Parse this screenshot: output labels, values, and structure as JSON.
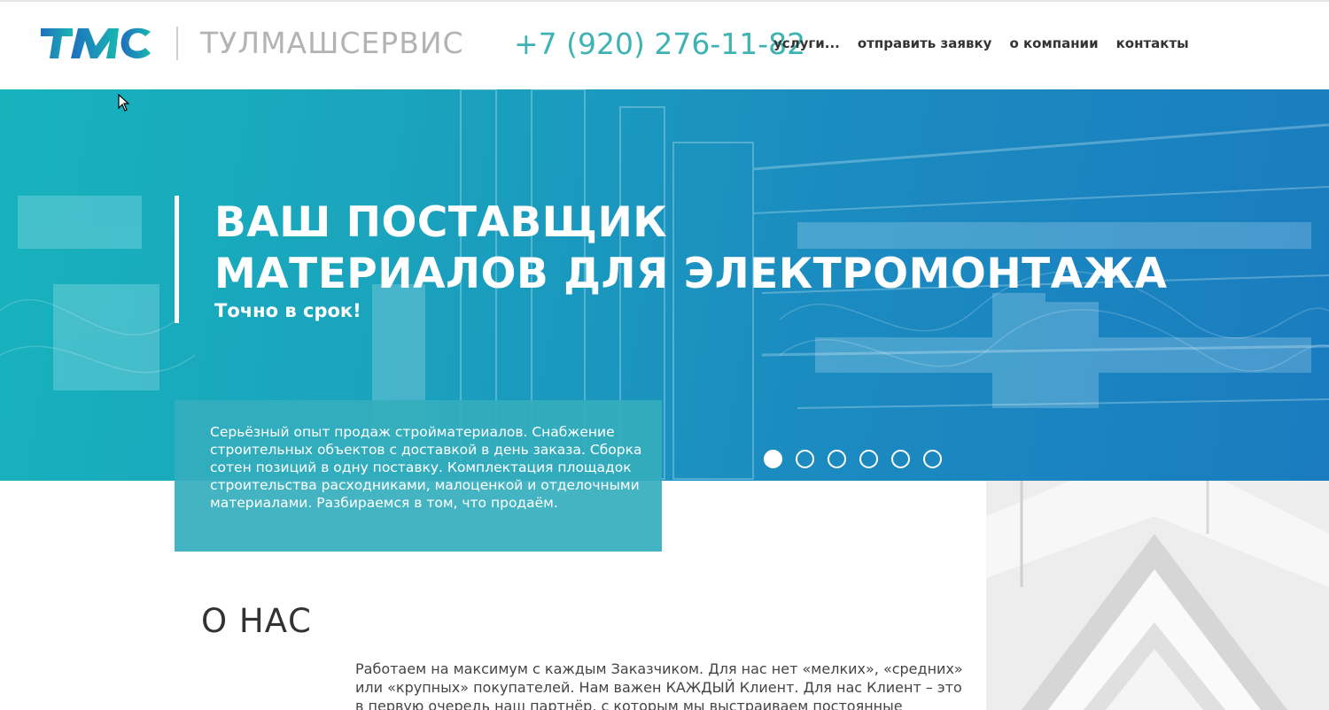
{
  "header": {
    "logo_text": "ТУЛМАШСЕРВИС",
    "phone": "+7 (920) 276-11-82",
    "nav": [
      {
        "label": "услуги..."
      },
      {
        "label": "отправить заявку"
      },
      {
        "label": "о компании"
      },
      {
        "label": "контакты"
      }
    ]
  },
  "hero": {
    "title_line1": "ВАШ ПОСТАВЩИК",
    "title_line2": "МАТЕРИАЛОВ ДЛЯ ЭЛЕКТРОМОНТАЖА",
    "subtitle": "Точно в срок!",
    "slides_total": 6,
    "active_slide": 1
  },
  "infobox": {
    "text": "Серьёзный опыт продаж стройматериалов. Снабжение строительных объектов с доставкой в день заказа. Сборка сотен позиций в одну поставку. Комплектация площадок строительства расходниками, малоценкой и отделочными материалами. Разбираемся в том, что продаём."
  },
  "about": {
    "title": "О НАС",
    "text": "Работаем на максимум с каждым Заказчиком. Для нас нет «мелких», «средних» или «крупных» покупателей. Нам важен КАЖДЫЙ Клиент. Для нас Клиент – это в первую очередь наш партнёр, с которым мы выстраиваем постоянные"
  },
  "colors": {
    "accent": "#3fb3b3",
    "hero_start": "#17b3bd",
    "hero_end": "#1a7cbf",
    "infobox": "#34aebd"
  }
}
